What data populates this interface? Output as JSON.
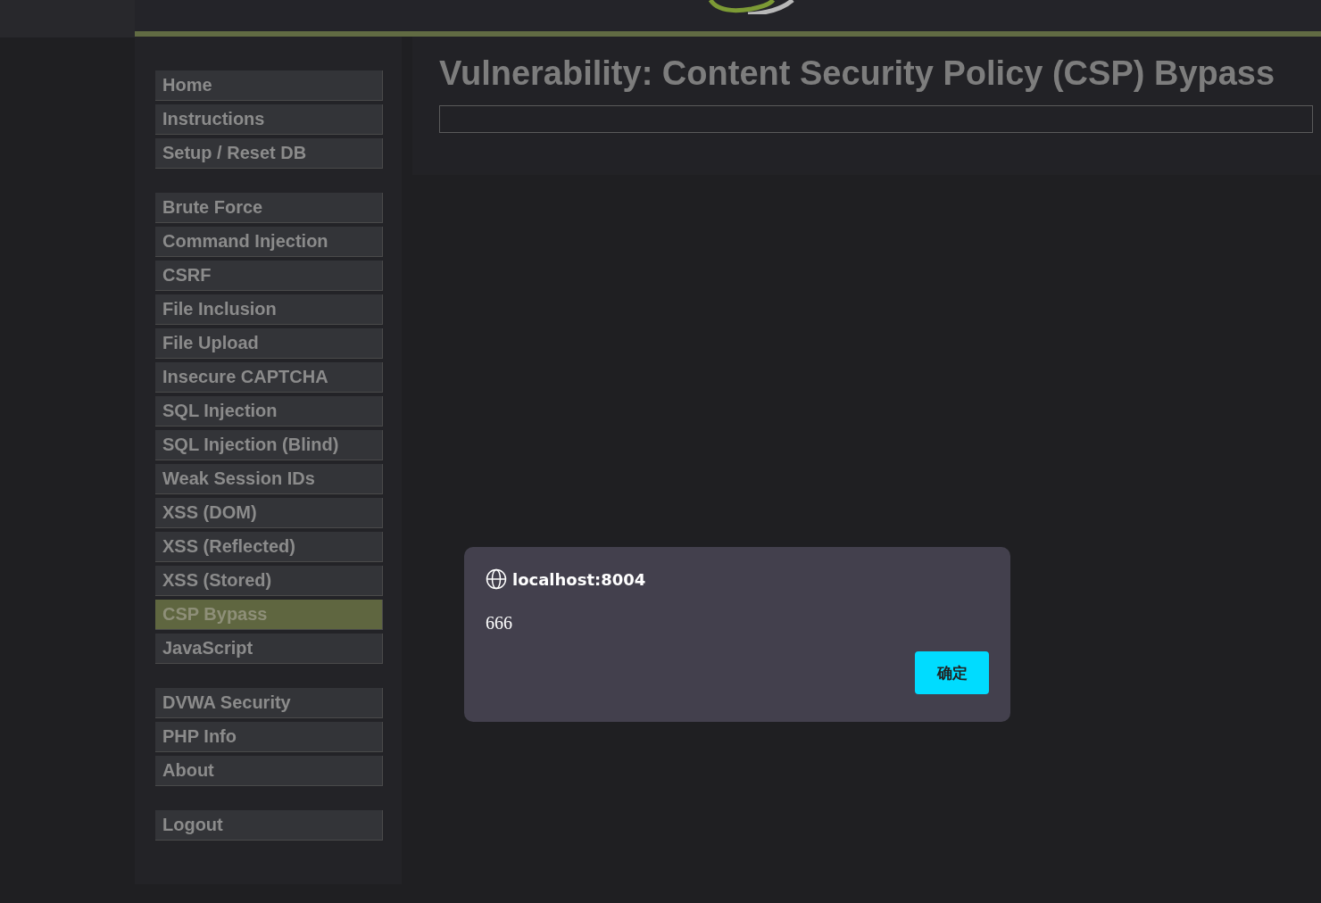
{
  "menu_groups": [
    {
      "items": [
        {
          "label": "Home",
          "selected": false
        },
        {
          "label": "Instructions",
          "selected": false
        },
        {
          "label": "Setup / Reset DB",
          "selected": false
        }
      ]
    },
    {
      "items": [
        {
          "label": "Brute Force",
          "selected": false
        },
        {
          "label": "Command Injection",
          "selected": false
        },
        {
          "label": "CSRF",
          "selected": false
        },
        {
          "label": "File Inclusion",
          "selected": false
        },
        {
          "label": "File Upload",
          "selected": false
        },
        {
          "label": "Insecure CAPTCHA",
          "selected": false
        },
        {
          "label": "SQL Injection",
          "selected": false
        },
        {
          "label": "SQL Injection (Blind)",
          "selected": false
        },
        {
          "label": "Weak Session IDs",
          "selected": false
        },
        {
          "label": "XSS (DOM)",
          "selected": false
        },
        {
          "label": "XSS (Reflected)",
          "selected": false
        },
        {
          "label": "XSS (Stored)",
          "selected": false
        },
        {
          "label": "CSP Bypass",
          "selected": true
        },
        {
          "label": "JavaScript",
          "selected": false
        }
      ]
    },
    {
      "items": [
        {
          "label": "DVWA Security",
          "selected": false
        },
        {
          "label": "PHP Info",
          "selected": false
        },
        {
          "label": "About",
          "selected": false
        }
      ]
    },
    {
      "items": [
        {
          "label": "Logout",
          "selected": false
        }
      ]
    }
  ],
  "page_title": "Vulnerability: Content Security Policy (CSP) Bypass",
  "alert_dialog": {
    "origin": "localhost:8004",
    "message": "666",
    "ok_button": "确定"
  }
}
